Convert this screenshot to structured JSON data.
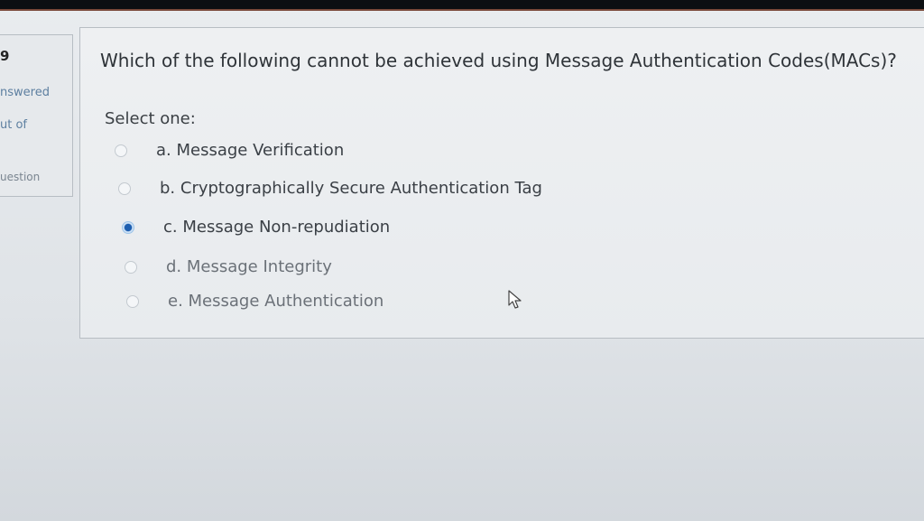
{
  "sidebar": {
    "question_number": "9",
    "state": "nswered",
    "marks": "ut of",
    "flag_label": "uestion"
  },
  "question": {
    "text": "Which of the following cannot be achieved using Message Authentication Codes(MACs)?",
    "prompt": "Select one:",
    "options": [
      {
        "label": "a. Message Verification",
        "selected": false
      },
      {
        "label": "b. Cryptographically Secure Authentication Tag",
        "selected": false
      },
      {
        "label": "c. Message Non-repudiation",
        "selected": true
      },
      {
        "label": "d. Message Integrity",
        "selected": false
      },
      {
        "label": "e. Message Authentication",
        "selected": false
      }
    ]
  },
  "colors": {
    "top_bar": "#0c0f12",
    "selected_radio": "#1e5fb0",
    "muted_link": "#5d7fa0"
  },
  "icons": {
    "cursor": "mouse-pointer-icon"
  }
}
